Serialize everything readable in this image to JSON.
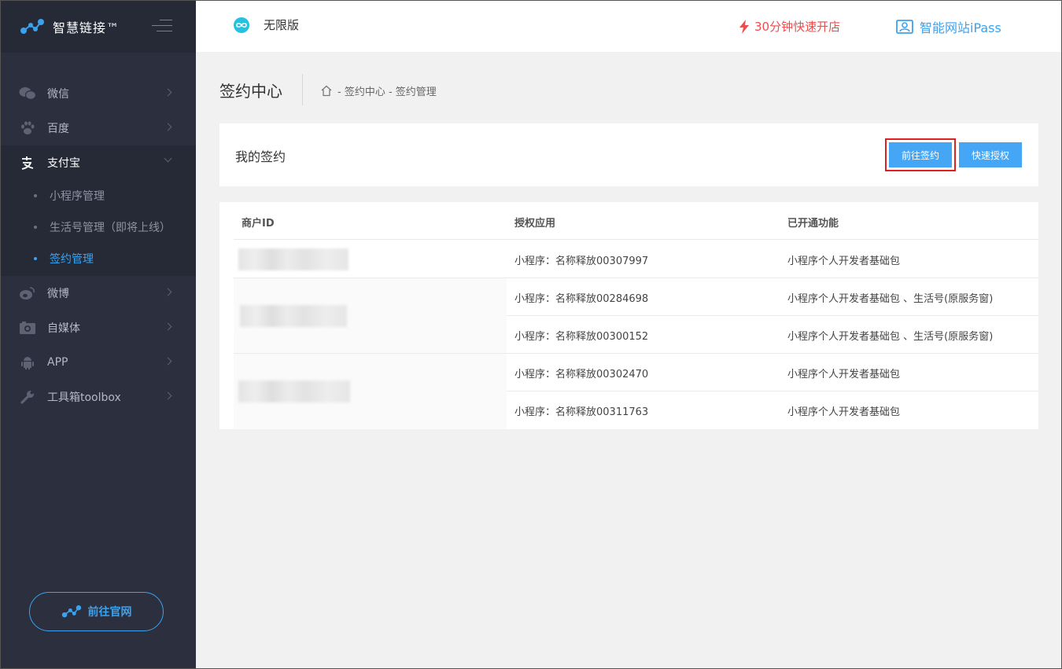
{
  "brand": {
    "name": "智慧链接™"
  },
  "sidebar": {
    "items": [
      {
        "label": "微信",
        "icon": "wechat-icon"
      },
      {
        "label": "百度",
        "icon": "paw-icon"
      },
      {
        "label": "支付宝",
        "icon": "alipay-icon",
        "expanded": true,
        "children": [
          {
            "label": "小程序管理"
          },
          {
            "label": "生活号管理（即将上线）"
          },
          {
            "label": "签约管理",
            "current": true
          }
        ]
      },
      {
        "label": "微博",
        "icon": "weibo-icon"
      },
      {
        "label": "自媒体",
        "icon": "camera-icon"
      },
      {
        "label": "APP",
        "icon": "android-icon"
      },
      {
        "label": "工具箱toolbox",
        "icon": "wrench-icon"
      }
    ],
    "site_button": "前往官网"
  },
  "header": {
    "edition": "无限版",
    "quick_open": "30分钟快速开店",
    "ipass": "智能网站iPass"
  },
  "page": {
    "title": "签约中心",
    "breadcrumb": "- 签约中心 - 签约管理"
  },
  "panel": {
    "title": "我的签约",
    "sign_button": "前往签约",
    "auth_button": "快速授权"
  },
  "table": {
    "headers": [
      "商户ID",
      "授权应用",
      "已开通功能"
    ],
    "rows": [
      {
        "app": "小程序：名称释放00307997",
        "feature": "小程序个人开发者基础包"
      },
      {
        "app": "小程序：名称释放00284698",
        "feature": "小程序个人开发者基础包 、生活号(原服务窗)"
      },
      {
        "app": "小程序：名称释放00300152",
        "feature": "小程序个人开发者基础包 、生活号(原服务窗)"
      },
      {
        "app": "小程序：名称释放00302470",
        "feature": "小程序个人开发者基础包"
      },
      {
        "app": "小程序：名称释放00311763",
        "feature": "小程序个人开发者基础包"
      }
    ]
  },
  "colors": {
    "accent": "#3aa3f0",
    "sidebar_bg": "#2b2f3e",
    "button": "#45a6f5",
    "alert": "#ee4d4d",
    "highlight": "#e02020"
  }
}
